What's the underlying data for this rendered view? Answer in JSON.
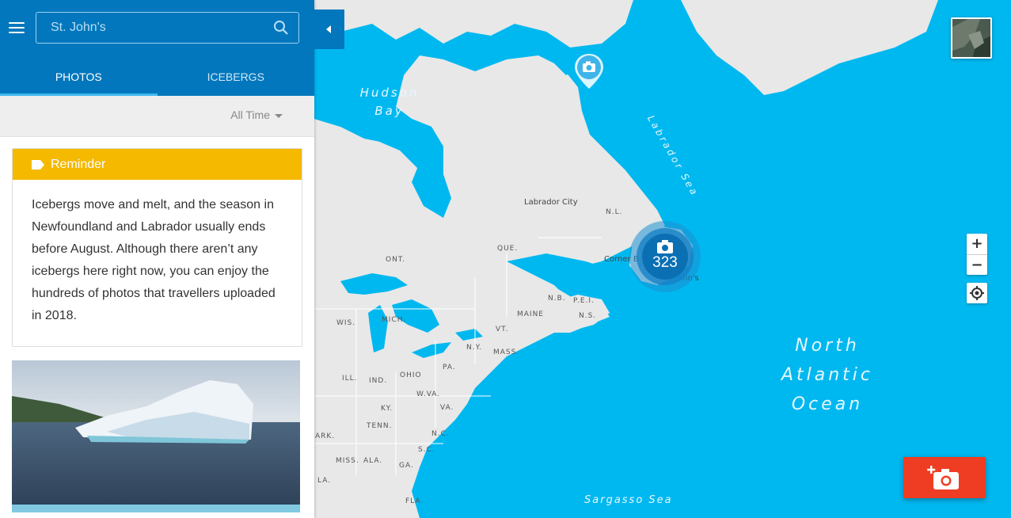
{
  "search": {
    "placeholder": "St. John's",
    "value": ""
  },
  "tabs": [
    {
      "label": "PHOTOS",
      "active": true
    },
    {
      "label": "ICEBERGS",
      "active": false
    }
  ],
  "filter": {
    "selected": "All Time"
  },
  "reminder": {
    "title": "Reminder",
    "body": "Icebergs move and melt, and the season in Newfoundland and Labrador usually ends before August. Although there aren’t any icebergs here right now, you can enjoy the hundreds of photos that travellers uploaded in 2018."
  },
  "map": {
    "water_labels": {
      "hudson": "Hudson Bay",
      "labrador": "Labrador Sea",
      "atlantic": "North Atlantic Ocean",
      "sargasso": "Sargasso Sea"
    },
    "cities": {
      "labrador_city": "Labrador City",
      "corner_brook": "Corner B",
      "st_johns_partial": "ohn's"
    },
    "regions": [
      "N.L.",
      "QUE.",
      "ONT.",
      "N.B.",
      "P.E.I.",
      "N.S.",
      "MAINE",
      "WIS.",
      "MICH.",
      "VT.",
      "N.Y.",
      "MASS.",
      "PA.",
      "OHIO",
      "IND.",
      "ILL.",
      "W.VA.",
      "KY.",
      "VA.",
      "TENN.",
      "N.C.",
      "S.C.",
      "GA.",
      "ALA.",
      "MISS.",
      "ARK.",
      "LA.",
      "FLA."
    ],
    "cluster_count": "323"
  },
  "controls": {
    "zoom_in": "+",
    "zoom_out": "−"
  },
  "colors": {
    "header": "#0277bd",
    "reminder": "#f5b900",
    "water": "#00b8f0",
    "land": "#e8e8e8",
    "add_button": "#ef3d23",
    "cluster": "#0277bd"
  },
  "icons": [
    "hamburger-icon",
    "search-icon",
    "collapse-arrow-icon",
    "caret-down-icon",
    "tag-icon",
    "camera-icon",
    "add-photo-icon",
    "locate-icon"
  ]
}
